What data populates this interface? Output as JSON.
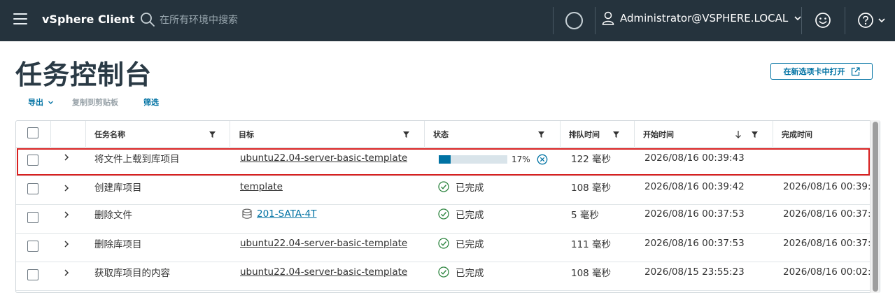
{
  "header": {
    "app_title": "vSphere Client",
    "search_placeholder": "在所有环境中搜索",
    "user": "Administrator@VSPHERE.LOCAL"
  },
  "page": {
    "title": "任务控制台",
    "open_in_new_tab": "在新选项卡中打开"
  },
  "toolbar": {
    "export": "导出",
    "copy_to_clipboard": "复制到剪贴板",
    "filter": "筛选"
  },
  "table": {
    "columns": {
      "task_name": "任务名称",
      "target": "目标",
      "status": "状态",
      "queued_time": "排队时间",
      "start_time": "开始时间",
      "completion_time": "完成时间"
    },
    "rows": [
      {
        "task_name": "将文件上载到库项目",
        "target": "ubuntu22.04-server-basic-template",
        "status_progress_text": "17%",
        "status_progress_value": 17,
        "queued_time": "122 毫秒",
        "start_time": "2026/08/16 00:39:43",
        "completion_time": ""
      },
      {
        "task_name": "创建库项目",
        "target": "template",
        "status": "已完成",
        "queued_time": "108 毫秒",
        "start_time": "2026/08/16 00:39:42",
        "completion_time": "2026/08/16 00:39:"
      },
      {
        "task_name": "删除文件",
        "target": "201-SATA-4T",
        "status": "已完成",
        "queued_time": "5 毫秒",
        "start_time": "2026/08/16 00:37:53",
        "completion_time": "2026/08/16 00:37:"
      },
      {
        "task_name": "删除库项目",
        "target": "ubuntu22.04-server-basic-template",
        "status": "已完成",
        "queued_time": "111 毫秒",
        "start_time": "2026/08/16 00:37:53",
        "completion_time": "2026/08/16 00:37:"
      },
      {
        "task_name": "获取库项目的内容",
        "target": "ubuntu22.04-server-basic-template",
        "status": "已完成",
        "queued_time": "108 毫秒",
        "start_time": "2026/08/15 23:55:23",
        "completion_time": "2026/08/16 00:02:"
      }
    ]
  },
  "colors": {
    "header_bg": "#25333d",
    "accent": "#0072a3",
    "success": "#2e8540",
    "highlight": "#d82020"
  }
}
